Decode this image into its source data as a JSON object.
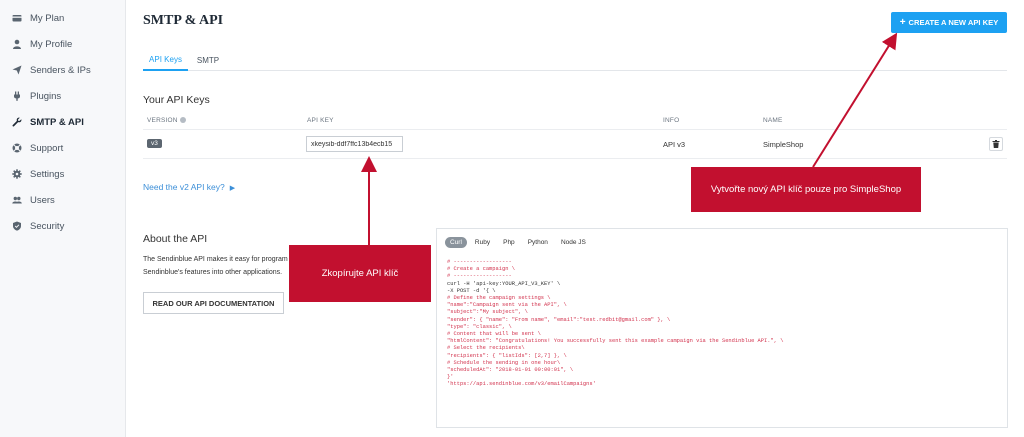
{
  "sidebar": {
    "items": [
      {
        "label": "My Plan",
        "icon": "card-icon"
      },
      {
        "label": "My Profile",
        "icon": "user-icon"
      },
      {
        "label": "Senders & IPs",
        "icon": "send-icon"
      },
      {
        "label": "Plugins",
        "icon": "plug-icon"
      },
      {
        "label": "SMTP & API",
        "icon": "wrench-icon"
      },
      {
        "label": "Support",
        "icon": "lifebuoy-icon"
      },
      {
        "label": "Settings",
        "icon": "gear-icon"
      },
      {
        "label": "Users",
        "icon": "users-icon"
      },
      {
        "label": "Security",
        "icon": "shield-icon"
      }
    ]
  },
  "header": {
    "title": "SMTP & API",
    "create_button": "CREATE A NEW API KEY",
    "create_icon": "+"
  },
  "tabs": [
    "API Keys",
    "SMTP"
  ],
  "api_keys": {
    "title": "Your API Keys",
    "columns": [
      "VERSION",
      "API KEY",
      "INFO",
      "NAME"
    ],
    "row": {
      "version": "v3",
      "key": "xkeysib-ddf7ffc13b4ecb15",
      "info": "API v3",
      "name": "SimpleShop"
    },
    "v2_link": "Need the v2 API key?",
    "v2_caret": "▶"
  },
  "about": {
    "title": "About the API",
    "text_line1": "The Sendinblue API makes it easy for program",
    "text_line2": "Sendinblue's features into other applications.",
    "doc_button": "READ OUR API DOCUMENTATION"
  },
  "code": {
    "tabs": [
      "Curl",
      "Ruby",
      "Php",
      "Python",
      "Node JS"
    ],
    "lines": [
      {
        "t": "# ------------------",
        "c": true
      },
      {
        "t": "# Create a campaign \\",
        "c": true
      },
      {
        "t": "# ------------------",
        "c": true
      },
      {
        "t": "curl -H 'api-key:YOUR_API_V3_KEY' \\",
        "c": false
      },
      {
        "t": "-X POST -d '{ \\",
        "c": false
      },
      {
        "t": "# Define the campaign settings \\",
        "c": true
      },
      {
        "t": "\"name\":\"Campaign sent via the API\", \\",
        "c": true
      },
      {
        "t": "\"subject\":\"My subject\", \\",
        "c": true
      },
      {
        "t": "\"sender\": { \"name\": \"From name\", \"email\":\"test.redbit@gmail.com\" }, \\",
        "c": true
      },
      {
        "t": "\"type\": \"classic\", \\",
        "c": true
      },
      {
        "t": "# Content that will be sent \\",
        "c": true
      },
      {
        "t": "\"htmlContent\": \"Congratulations! You successfully sent this example campaign via the Sendinblue API.\", \\",
        "c": true
      },
      {
        "t": "# Select the recipients\\",
        "c": true
      },
      {
        "t": "\"recipients\": { \"listIds\": [2,7] }, \\",
        "c": true
      },
      {
        "t": "# Schedule the sending in one hour\\",
        "c": true
      },
      {
        "t": "\"scheduledAt\": \"2018-01-01 00:00:01\", \\",
        "c": true
      },
      {
        "t": "}'",
        "c": true
      },
      {
        "t": "'https://api.sendinblue.com/v3/emailCampaigns'",
        "c": true
      }
    ]
  },
  "callouts": {
    "copy_key": "Zkopírujte API klíč",
    "create_key": "Vytvořte nový API klíč pouze pro SimpleShop"
  },
  "colors": {
    "accent": "#1da1f2",
    "callout": "#c2102f",
    "code_red": "#d2324d"
  }
}
